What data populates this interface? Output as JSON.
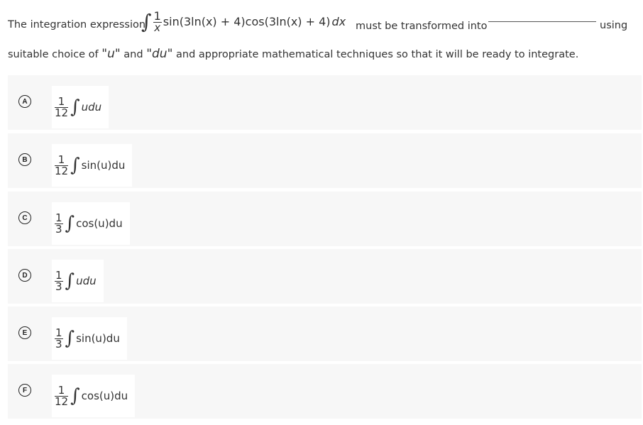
{
  "question": {
    "prefix": "The integration expression",
    "integral_symbol": "∫",
    "fraction_numerator": "1",
    "fraction_denominator": "x",
    "integrand": "sin(3ln(x) + 4)cos(3ln(x) + 4)",
    "differential": "dx",
    "middle": "must be transformed into",
    "suffix": "using",
    "line2_part1": "suitable choice of",
    "u_quoted": "\"u\"",
    "and_word": "and",
    "du_quoted": "\"du\"",
    "line2_part2": "and appropriate mathematical techniques so that it will be ready to integrate."
  },
  "options": [
    {
      "letter": "A",
      "numerator": "1",
      "denominator": "12",
      "integral": "∫",
      "body": "udu"
    },
    {
      "letter": "B",
      "numerator": "1",
      "denominator": "12",
      "integral": "∫",
      "body": "sin(u)du"
    },
    {
      "letter": "C",
      "numerator": "1",
      "denominator": "3",
      "integral": "∫",
      "body": "cos(u)du"
    },
    {
      "letter": "D",
      "numerator": "1",
      "denominator": "3",
      "integral": "∫",
      "body": "udu"
    },
    {
      "letter": "E",
      "numerator": "1",
      "denominator": "3",
      "integral": "∫",
      "body": "sin(u)du"
    },
    {
      "letter": "F",
      "numerator": "1",
      "denominator": "12",
      "integral": "∫",
      "body": "cos(u)du"
    }
  ]
}
